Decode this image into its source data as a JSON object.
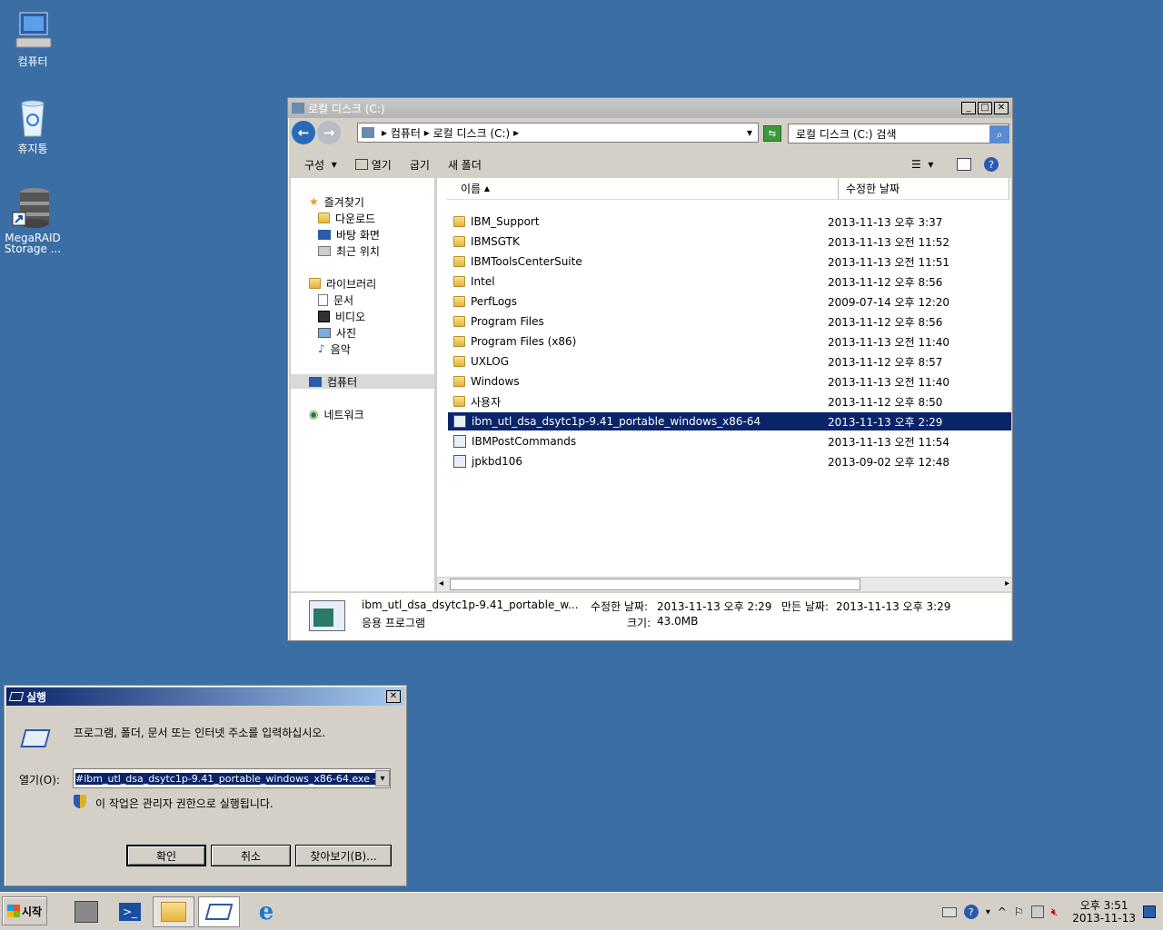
{
  "desktop": {
    "icons": [
      {
        "label": "컴퓨터"
      },
      {
        "label": "휴지통"
      },
      {
        "label": "MegaRAID Storage ..."
      }
    ]
  },
  "explorer": {
    "title": "로컬 디스크 (C:)",
    "breadcrumb": [
      "컴퓨터",
      "로컬 디스크 (C:)"
    ],
    "search_placeholder": "로컬 디스크 (C:) 검색",
    "toolbar": {
      "organize": "구성",
      "open": "열기",
      "burn": "굽기",
      "new_folder": "새 폴더"
    },
    "nav": {
      "favorites": "즐겨찾기",
      "favorites_items": [
        "다운로드",
        "바탕 화면",
        "최근 위치"
      ],
      "libraries": "라이브러리",
      "libraries_items": [
        "문서",
        "비디오",
        "사진",
        "음악"
      ],
      "computer": "컴퓨터",
      "network": "네트워크"
    },
    "columns": {
      "name": "이름",
      "modified": "수정한 날짜"
    },
    "files": [
      {
        "name": "IBM_Support",
        "date": "2013-11-13 오후 3:37",
        "kind": "folder"
      },
      {
        "name": "IBMSGTK",
        "date": "2013-11-13 오전 11:52",
        "kind": "folder"
      },
      {
        "name": "IBMToolsCenterSuite",
        "date": "2013-11-13 오전 11:51",
        "kind": "folder"
      },
      {
        "name": "Intel",
        "date": "2013-11-12 오후 8:56",
        "kind": "folder"
      },
      {
        "name": "PerfLogs",
        "date": "2009-07-14 오후 12:20",
        "kind": "folder"
      },
      {
        "name": "Program Files",
        "date": "2013-11-12 오후 8:56",
        "kind": "folder"
      },
      {
        "name": "Program Files (x86)",
        "date": "2013-11-13 오전 11:40",
        "kind": "folder"
      },
      {
        "name": "UXLOG",
        "date": "2013-11-12 오후 8:57",
        "kind": "folder"
      },
      {
        "name": "Windows",
        "date": "2013-11-13 오전 11:40",
        "kind": "folder"
      },
      {
        "name": "사용자",
        "date": "2013-11-12 오후 8:50",
        "kind": "folder"
      },
      {
        "name": "ibm_utl_dsa_dsytc1p-9.41_portable_windows_x86-64",
        "date": "2013-11-13 오후 2:29",
        "kind": "app",
        "selected": true
      },
      {
        "name": "IBMPostCommands",
        "date": "2013-11-13 오전 11:54",
        "kind": "file"
      },
      {
        "name": "jpkbd106",
        "date": "2013-09-02 오후 12:48",
        "kind": "file"
      }
    ],
    "details": {
      "name": "ibm_utl_dsa_dsytc1p-9.41_portable_w...",
      "type": "응용 프로그램",
      "modified_label": "수정한 날짜:",
      "modified": "2013-11-13 오후 2:29",
      "created_label": "만든 날짜:",
      "created": "2013-11-13 오후 3:29",
      "size_label": "크기:",
      "size": "43.0MB"
    }
  },
  "run": {
    "title": "실행",
    "prompt": "프로그램, 폴더, 문서 또는 인터넷 주소를 입력하십시오.",
    "open_label": "열기(O):",
    "input_value": "#ibm_utl_dsa_dsytc1p-9.41_portable_windows_x86-64.exe -v",
    "admin_note": "이 작업은 관리자 권한으로 실행됩니다.",
    "ok": "확인",
    "cancel": "취소",
    "browse": "찾아보기(B)..."
  },
  "taskbar": {
    "start": "시작",
    "time": "오후 3:51",
    "date": "2013-11-13"
  }
}
